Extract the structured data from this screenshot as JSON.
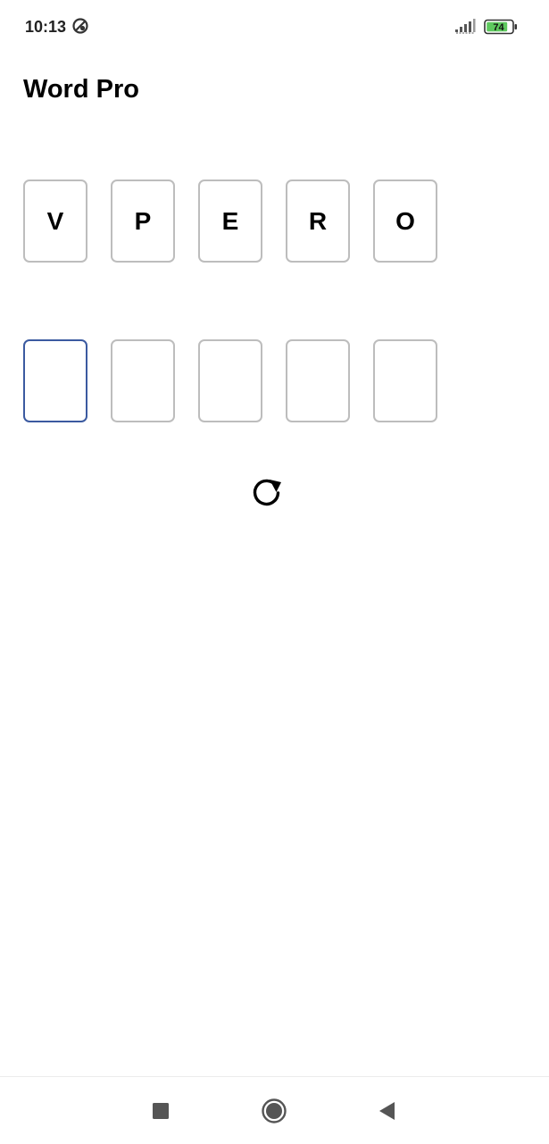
{
  "status_bar": {
    "time": "10:13",
    "app_icon": "no-sign-icon",
    "signal_icon": "cellular-signal-icon",
    "battery_level": "74",
    "battery_color": "#5ec95e"
  },
  "app": {
    "title": "Word Pro"
  },
  "letters": [
    "V",
    "P",
    "E",
    "R",
    "O"
  ],
  "answer_slots": [
    "",
    "",
    "",
    "",
    ""
  ],
  "active_slot_color": "#3b5aa0",
  "refresh_icon": "refresh-icon",
  "nav_bar": {
    "recents_icon": "square-icon",
    "home_icon": "circle-icon",
    "back_icon": "triangle-back-icon"
  }
}
